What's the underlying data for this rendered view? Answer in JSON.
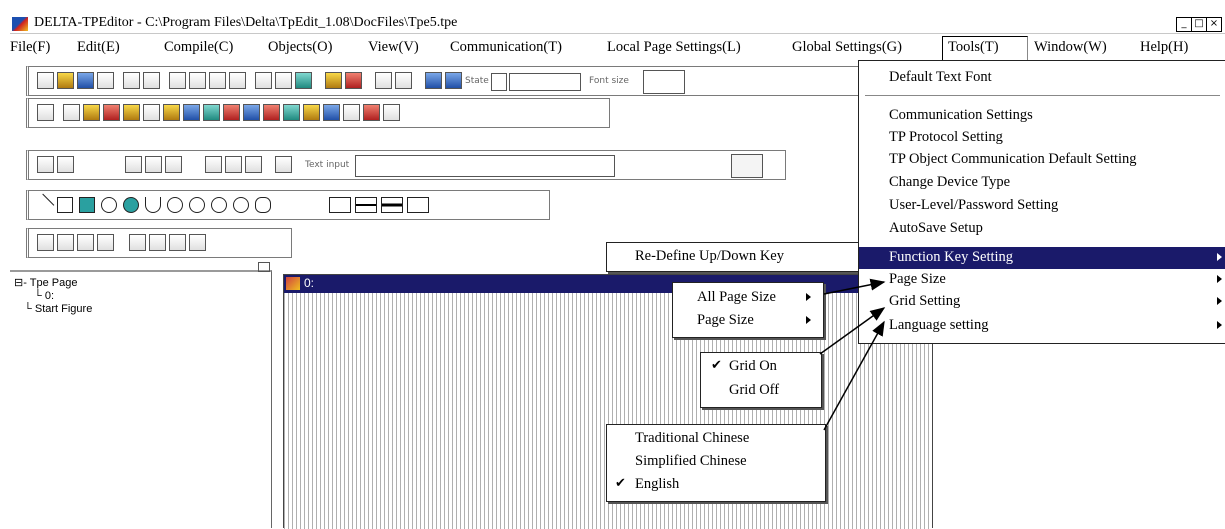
{
  "window": {
    "title": "DELTA-TPEditor - C:\\Program Files\\Delta\\TpEdit_1.08\\DocFiles\\Tpe5.tpe",
    "minimize": "_",
    "maximize": "□",
    "close": "×"
  },
  "menubar": {
    "items": [
      "File(F)",
      "Edit(E)",
      "Compile(C)",
      "Objects(O)",
      "View(V)",
      "Communication(T)",
      "Local Page Settings(L)",
      "Global Settings(G)",
      "Tools(T)",
      "Window(W)",
      "Help(H)"
    ]
  },
  "toolbar": {
    "state_label": "State",
    "font_size_label": "Font size",
    "text_input_label": "Text input"
  },
  "tree": {
    "root": "Tpe Page",
    "child": "0:",
    "start": "Start Figure"
  },
  "child_window": {
    "title": "0:"
  },
  "tools_menu": {
    "items": [
      "Default Text Font",
      "Communication Settings",
      "TP Protocol Setting",
      "TP Object Communication Default Setting",
      "Change Device Type",
      "User-Level/Password Setting",
      "AutoSave Setup",
      "Function Key Setting",
      "Page Size",
      "Grid Setting",
      "Language setting"
    ],
    "selected": "Function Key Setting"
  },
  "function_key_submenu": {
    "item": "Re-Define Up/Down Key"
  },
  "page_size_submenu": {
    "items": [
      "All Page Size",
      "Page Size"
    ]
  },
  "grid_submenu": {
    "items": [
      "Grid On",
      "Grid Off"
    ],
    "checked": "Grid On"
  },
  "language_submenu": {
    "items": [
      "Traditional Chinese",
      "Simplified Chinese",
      "English"
    ],
    "checked": "English"
  },
  "glyphs": {
    "check": "✔"
  }
}
